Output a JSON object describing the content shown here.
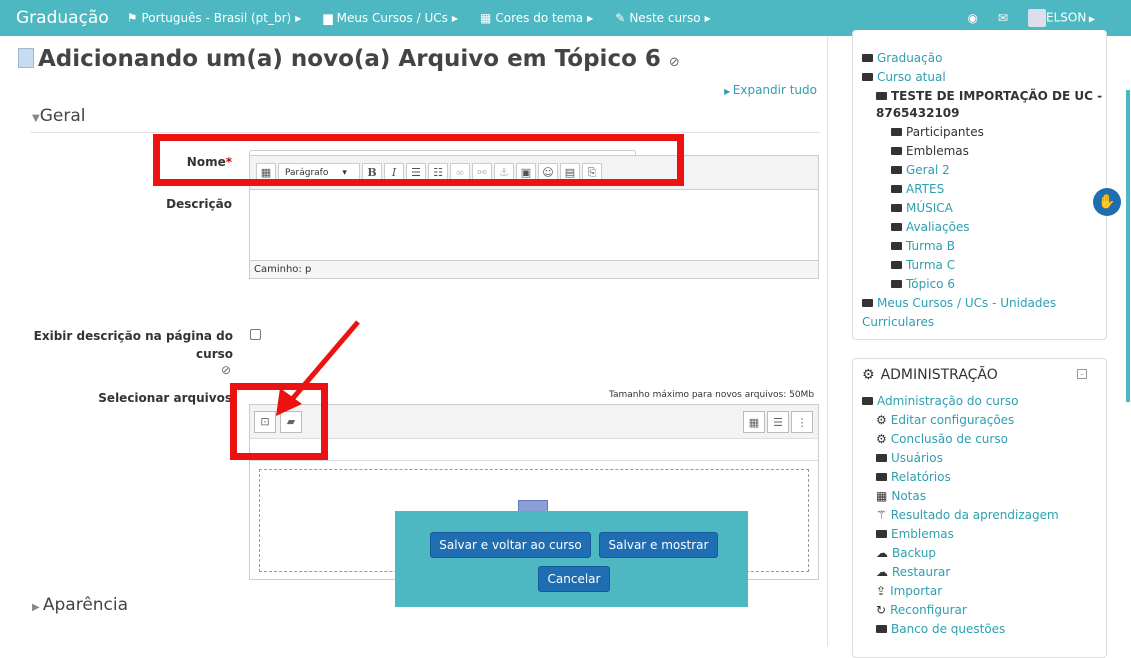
{
  "topbar": {
    "brand": "Graduação",
    "items": [
      {
        "icon": "flag-icon",
        "label": "Português - Brasil (pt_br)"
      },
      {
        "icon": "briefcase-icon",
        "label": "Meus Cursos / UCs"
      },
      {
        "icon": "grid-icon",
        "label": "Cores do tema"
      },
      {
        "icon": "pencil-icon",
        "label": "Neste curso"
      }
    ],
    "user": "ELSON"
  },
  "page": {
    "title": "Adicionando um(a) novo(a) Arquivo em Tópico 6",
    "expand_all": "Expandir tudo",
    "section_general": "Geral",
    "section_appearance": "Aparência",
    "name_label": "Nome",
    "name_required": "*",
    "name_value": "",
    "description_label": "Descrição",
    "editor_format": "Parágrafo",
    "editor_path": "Caminho: p",
    "show_description_label": "Exibir descrição na página do curso",
    "select_files_label": "Selecionar arquivos",
    "max_size": "Tamanho máximo para novos arquivos: 50Mb"
  },
  "modal": {
    "save_return": "Salvar e voltar ao curso",
    "save_show": "Salvar e mostrar",
    "cancel": "Cancelar"
  },
  "sidebar": {
    "nav": [
      {
        "label": "Graduação",
        "level": 0
      },
      {
        "label": "Curso atual",
        "level": 0
      },
      {
        "label": "TESTE DE IMPORTAÇÃO DE UC -",
        "level": 1,
        "bold": true
      },
      {
        "label": "8765432109",
        "level": 1,
        "bold": true
      },
      {
        "label": "Participantes",
        "level": 2
      },
      {
        "label": "Emblemas",
        "level": 2
      },
      {
        "label": "Geral 2",
        "level": 2
      },
      {
        "label": "ARTES",
        "level": 2
      },
      {
        "label": "MÚSICA",
        "level": 2
      },
      {
        "label": "Avaliações",
        "level": 2
      },
      {
        "label": "Turma B",
        "level": 2
      },
      {
        "label": "Turma C",
        "level": 2
      },
      {
        "label": "Tópico 6",
        "level": 2
      },
      {
        "label": "Meus Cursos / UCs - Unidades",
        "level": 0
      },
      {
        "label": "Curriculares",
        "level": 0
      }
    ],
    "admin_title": "ADMINISTRAÇÃO",
    "admin": [
      {
        "label": "Administração do curso"
      },
      {
        "label": "Editar configurações"
      },
      {
        "label": "Conclusão de curso"
      },
      {
        "label": "Usuários"
      },
      {
        "label": "Relatórios"
      },
      {
        "label": "Notas"
      },
      {
        "label": "Resultado da aprendizagem"
      },
      {
        "label": "Emblemas"
      },
      {
        "label": "Backup"
      },
      {
        "label": "Restaurar"
      },
      {
        "label": "Importar"
      },
      {
        "label": "Reconfigurar"
      },
      {
        "label": "Banco de questões"
      }
    ]
  }
}
